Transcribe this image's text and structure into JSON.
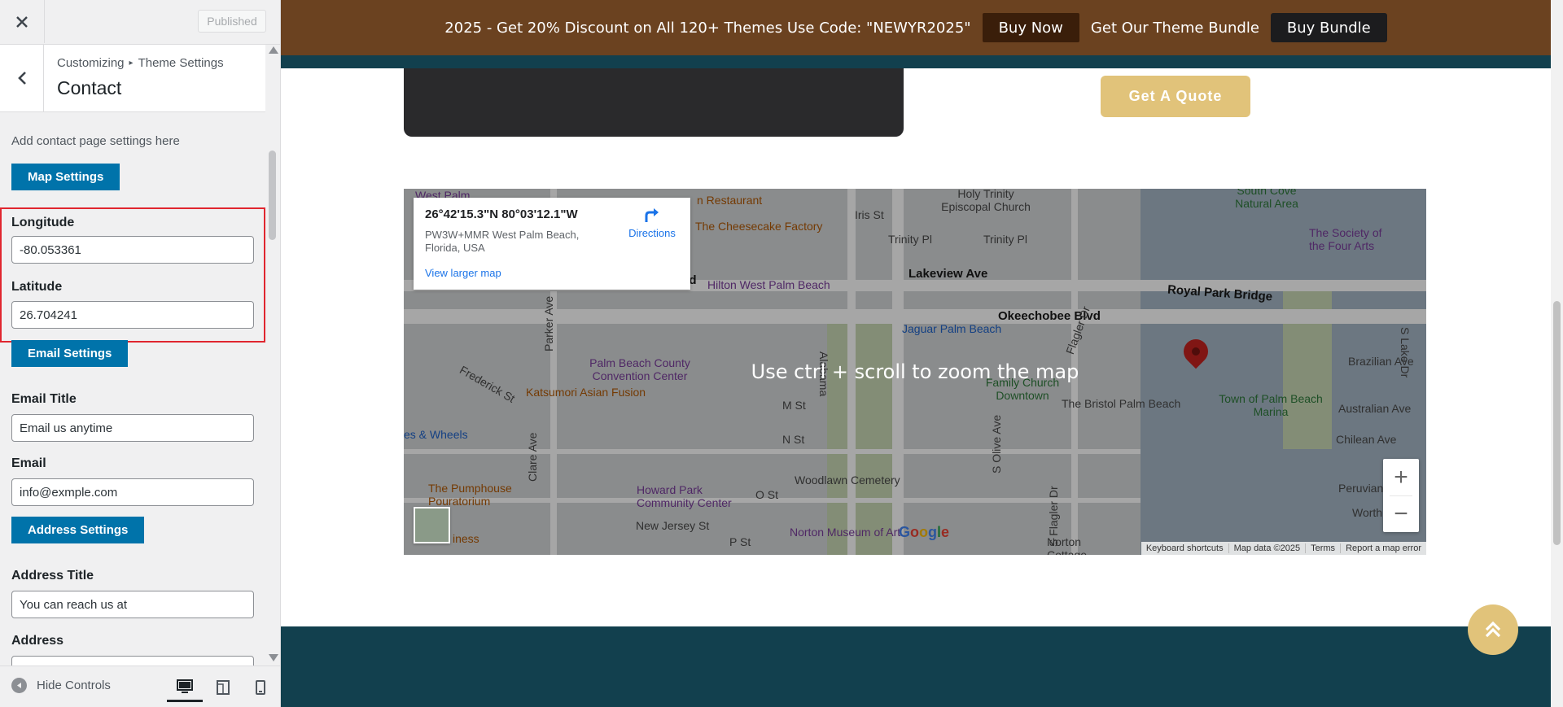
{
  "sidebar": {
    "published_label": "Published",
    "breadcrumb_root": "Customizing",
    "breadcrumb_sep": "▸",
    "breadcrumb_section": "Theme Settings",
    "section_title": "Contact",
    "description": "Add contact page settings here",
    "map_settings_label": "Map Settings",
    "longitude_label": "Longitude",
    "longitude_value": "-80.053361",
    "latitude_label": "Latitude",
    "latitude_value": "26.704241",
    "email_settings_label": "Email Settings",
    "email_title_label": "Email Title",
    "email_title_value": "Email us anytime",
    "email_label": "Email",
    "email_value": "info@exmple.com",
    "address_settings_label": "Address Settings",
    "address_title_label": "Address Title",
    "address_title_value": "You can reach us at",
    "address_label": "Address",
    "hide_controls_label": "Hide Controls"
  },
  "preview": {
    "promo_text": "2025 - Get 20% Discount on All 120+ Themes Use Code: \"NEWYR2025\"",
    "buy_now_label": "Buy Now",
    "bundle_text": "Get Our Theme Bundle",
    "buy_bundle_label": "Buy Bundle",
    "quote_label": "Get A Quote"
  },
  "map": {
    "coords": "26°42'15.3\"N 80°03'12.1\"W",
    "address_line": "PW3W+MMR West Palm Beach, Florida, USA",
    "directions_label": "Directions",
    "larger_map_label": "View larger map",
    "zoom_hint": "Use ctrl + scroll to zoom the map",
    "zoom_in": "+",
    "zoom_out": "−",
    "google_logo": "Google",
    "attribution": {
      "shortcuts": "Keyboard shortcuts",
      "data": "Map data ©2025",
      "terms": "Terms",
      "report": "Report a map error"
    },
    "labels": {
      "west_palm": "West Palm",
      "restaurant": "n Restaurant",
      "cheesecake": "The Cheesecake Factory",
      "hilton": "Hilton West Palm Beach",
      "iris": "Iris St",
      "holy_trinity": "Holy Trinity Episcopal Church",
      "trinity1": "Trinity Pl",
      "trinity2": "Trinity Pl",
      "lakeview": "Lakeview Ave",
      "okeechobee": "Okeechobee Blvd",
      "royal_park": "Royal Park Bridge",
      "jaguar": "Jaguar Palm Beach",
      "parker": "Parker Ave",
      "alabama": "Alabama",
      "flagler": "Flagler Dr",
      "convention": "Palm Beach County Convention Center",
      "frederick": "Frederick St",
      "katsumori": "Katsumori Asian Fusion",
      "family_church": "Family Church Downtown",
      "bristol": "The Bristol Palm Beach",
      "palm_marina": "Town of Palm Beach Marina",
      "brazilian": "Brazilian Ave",
      "australian": "Australian Ave",
      "chilean": "Chilean Ave",
      "peruvian": "Peruvian",
      "worth": "Worth",
      "m_st": "M St",
      "n_st": "N St",
      "o_st": "O St",
      "p_st": "P St",
      "olive": "S Olive Ave",
      "s_flagler": "S Flagler Dr",
      "wheels": "es & Wheels",
      "clare": "Clare Ave",
      "pumphouse": "The Pumphouse Pouratorium",
      "howard": "Howard Park Community Center",
      "new_jersey": "New Jersey St",
      "woodlawn": "Woodlawn Cemetery",
      "norton": "Norton Museum of Art",
      "society": "The Society of the Four Arts",
      "south_cove": "South Cove Natural Area",
      "s_lake": "S Lake Dr",
      "iness": "iness",
      "norton_ct": "Norton Cottage",
      "vd": "vd"
    }
  }
}
